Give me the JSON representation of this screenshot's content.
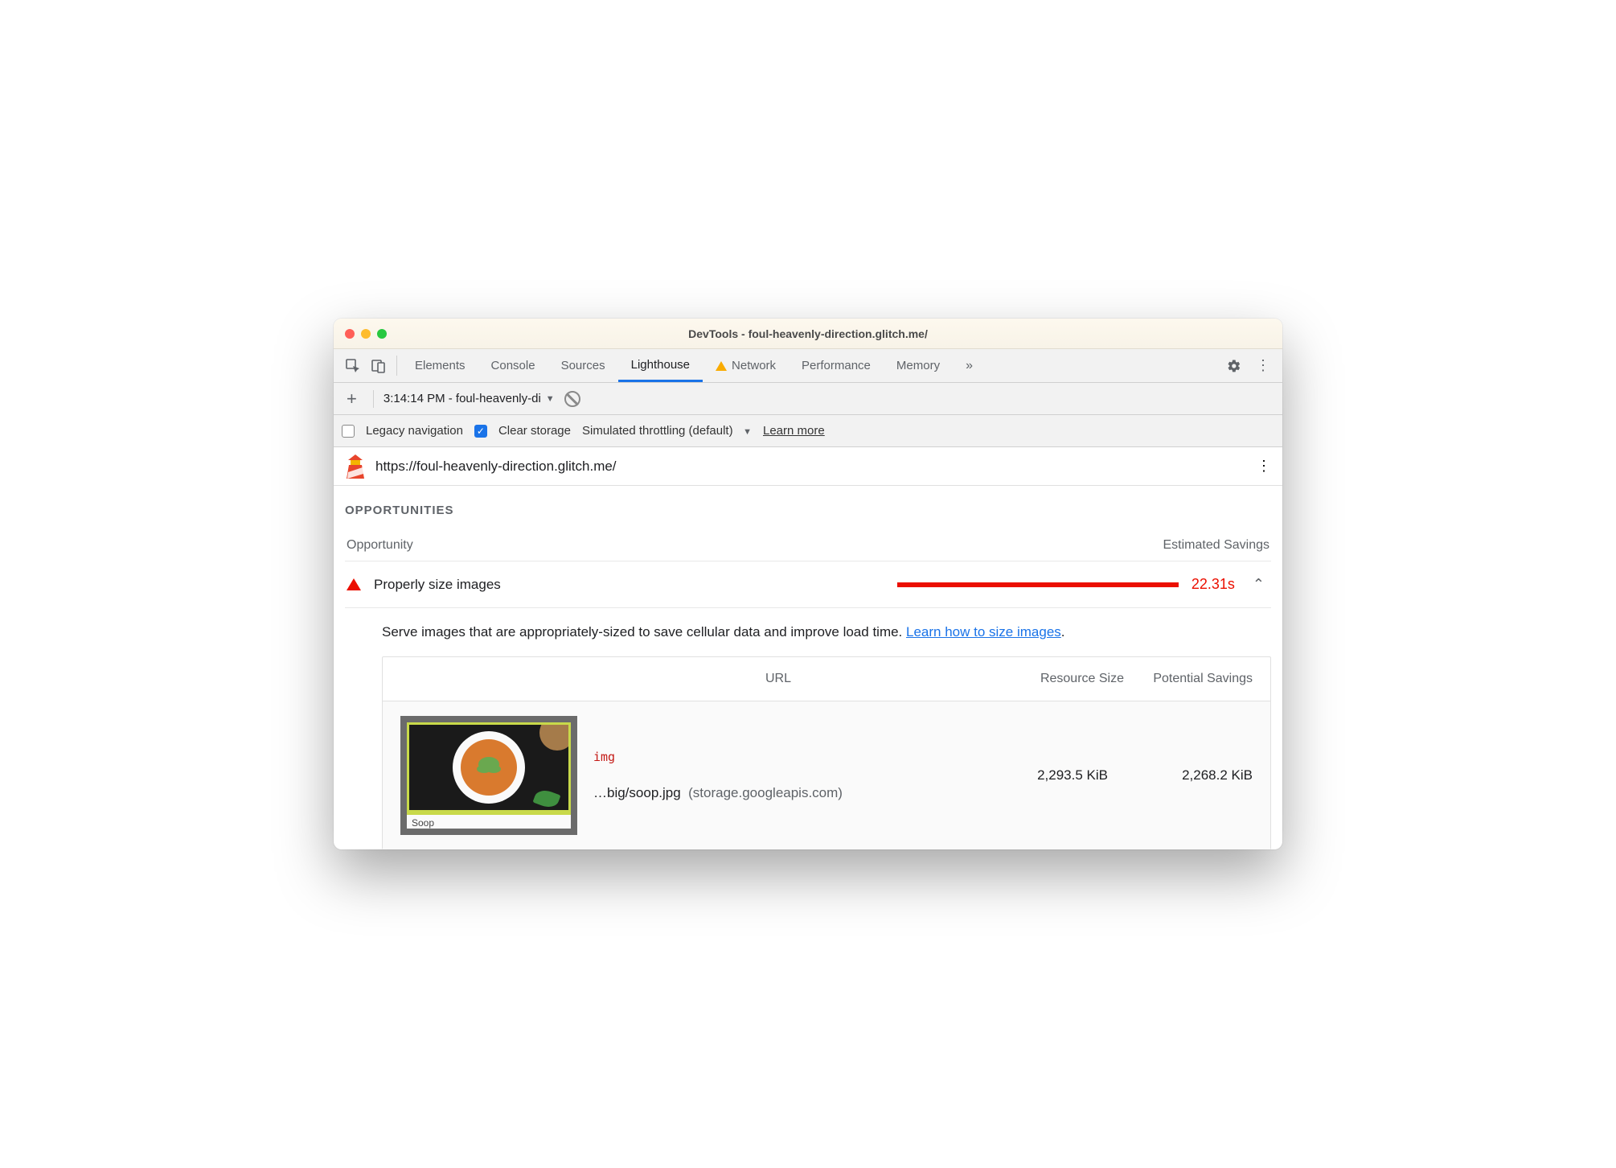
{
  "window": {
    "title": "DevTools - foul-heavenly-direction.glitch.me/"
  },
  "tabs": {
    "items": [
      "Elements",
      "Console",
      "Sources",
      "Lighthouse",
      "Network",
      "Performance",
      "Memory"
    ],
    "active": "Lighthouse",
    "warningOn": "Network"
  },
  "subbar": {
    "report": "3:14:14 PM - foul-heavenly-di"
  },
  "options": {
    "legacy_label": "Legacy navigation",
    "legacy_checked": false,
    "clear_label": "Clear storage",
    "clear_checked": true,
    "throttling": "Simulated throttling (default)",
    "learn_more": "Learn more"
  },
  "report": {
    "url": "https://foul-heavenly-direction.glitch.me/",
    "section": "OPPORTUNITIES",
    "col_opportunity": "Opportunity",
    "col_savings": "Estimated Savings",
    "item": {
      "title": "Properly size images",
      "time": "22.31s",
      "bar_pct": 100,
      "desc_a": "Serve images that are appropriately-sized to save cellular data and improve load time. ",
      "desc_link": "Learn how to size images",
      "desc_b": "."
    },
    "table": {
      "headers": {
        "url": "URL",
        "size": "Resource Size",
        "savings": "Potential Savings"
      },
      "row": {
        "tag": "img",
        "path": "…big/soop.jpg",
        "host": "(storage.googleapis.com)",
        "size": "2,293.5 KiB",
        "savings": "2,268.2 KiB",
        "caption": "Soop"
      }
    }
  }
}
